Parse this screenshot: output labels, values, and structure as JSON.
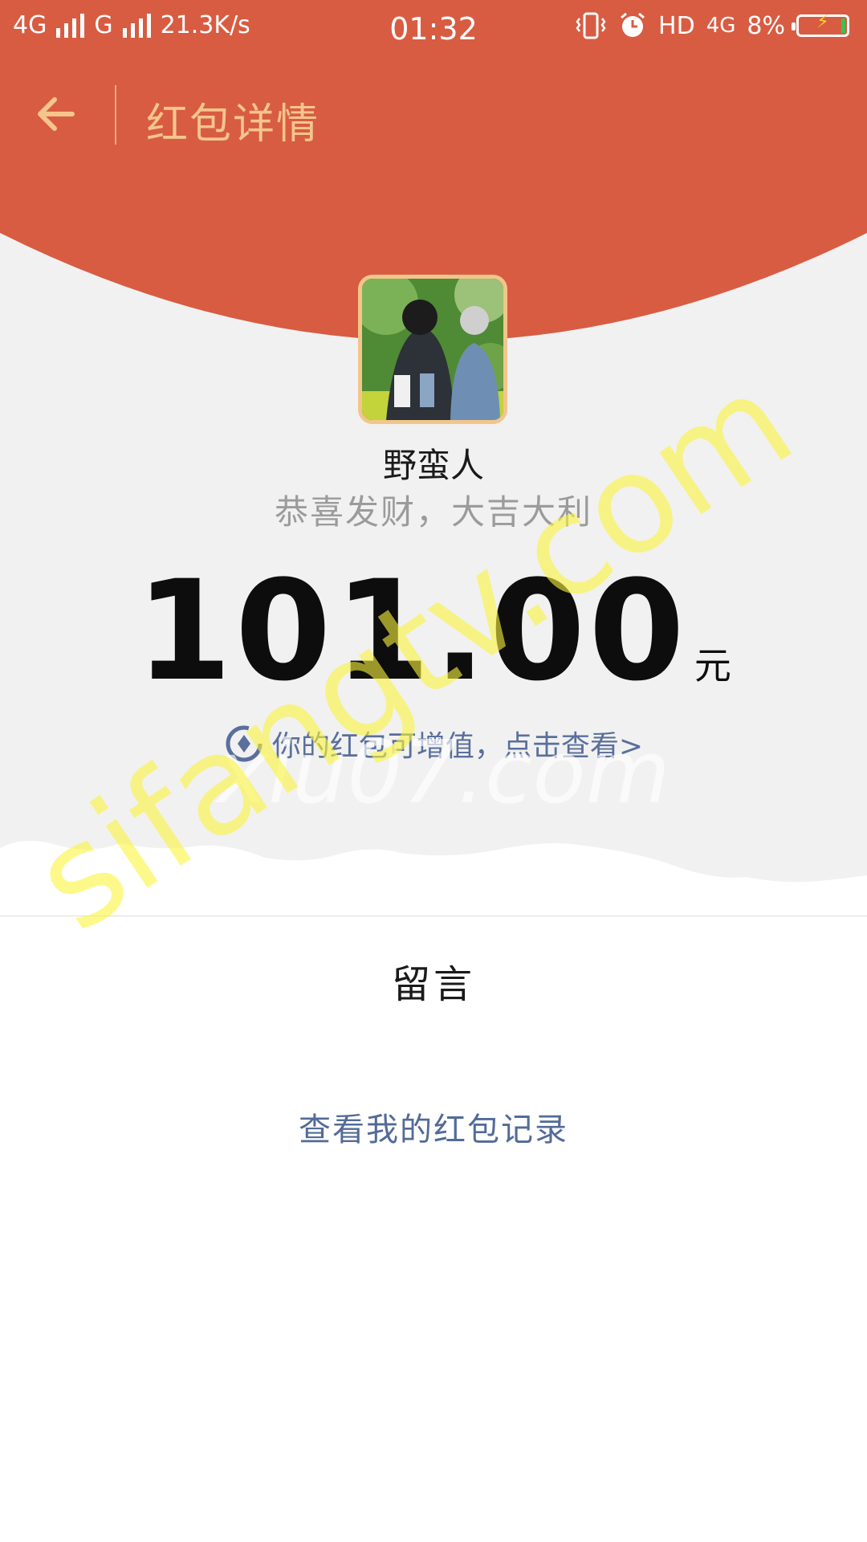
{
  "status_bar": {
    "network_1": "4G",
    "network_2": "G",
    "speed": "21.3K/s",
    "time": "01:32",
    "hd_label": "HD",
    "net_right": "4G",
    "battery": "8%"
  },
  "nav": {
    "back_icon": "back-arrow-icon",
    "title": "红包详情"
  },
  "sender": {
    "name": "野蛮人",
    "greeting": "恭喜发财，大吉大利"
  },
  "amount": {
    "value": "101.00",
    "unit": "元"
  },
  "grow_link": {
    "icon": "coin-icon",
    "text": "你的红包可增值，点击查看>"
  },
  "message_section": {
    "title": "留言"
  },
  "records_link": {
    "text": "查看我的红包记录"
  },
  "watermarks": {
    "faint": "xiu07.com",
    "yellow": "sifangtv.com"
  },
  "colors": {
    "header_red": "#d85c42",
    "title_gold": "#f4c58c",
    "link_blue": "#526b98",
    "background_grey": "#f1f1f1"
  }
}
